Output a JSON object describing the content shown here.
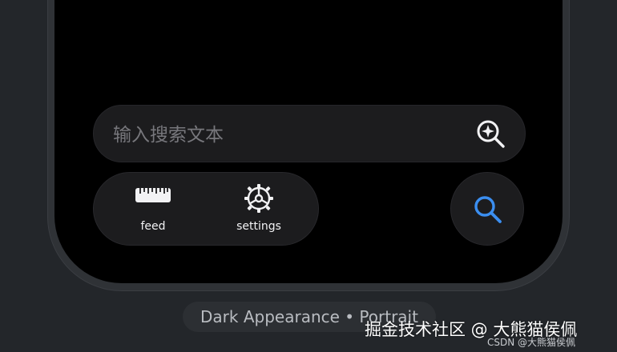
{
  "search": {
    "placeholder": "输入搜索文本",
    "value": "",
    "action_icon": "magnify-plus-icon"
  },
  "tabs": [
    {
      "label": "feed",
      "icon": "ruler-icon"
    },
    {
      "label": "settings",
      "icon": "gear-icon"
    }
  ],
  "search_button": {
    "icon": "search-icon",
    "accent": "#3b8ef0"
  },
  "caption": {
    "text": "Dark Appearance • Portrait"
  },
  "watermark": {
    "main": "掘金技术社区 @ 大熊猫侯佩",
    "sub": "CSDN @大熊猫侯佩"
  },
  "colors": {
    "background": "#23262a",
    "screen": "#000000",
    "control": "#1c1c1e",
    "label": "#f2f2f4",
    "placeholder": "#77777c"
  }
}
